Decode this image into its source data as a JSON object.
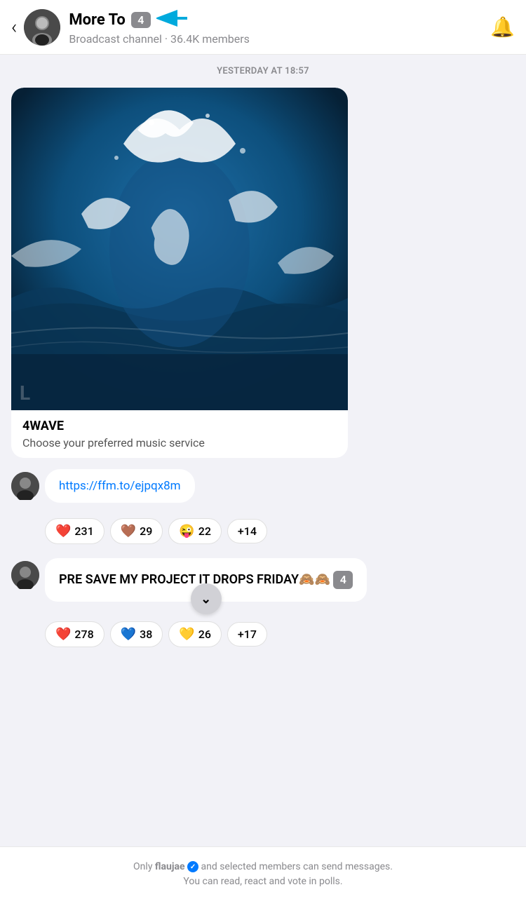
{
  "header": {
    "back_label": "‹",
    "channel_name": "More To",
    "badge_count": "4",
    "channel_type": "Broadcast channel",
    "member_count": "36.4K members",
    "notification_icon": "🔔"
  },
  "chat": {
    "date_divider": "YESTERDAY AT 18:57",
    "message1": {
      "title": "4WAVE",
      "subtitle": "Choose your preferred music service",
      "link": "https://ffm.to/ejpqx8m",
      "reactions": [
        {
          "emoji": "❤️",
          "count": "231"
        },
        {
          "emoji": "🤎",
          "count": "29"
        },
        {
          "emoji": "😜",
          "count": "22"
        },
        {
          "label": "+14"
        }
      ]
    },
    "message2": {
      "text": "PRE SAVE MY PROJECT IT DROPS FRIDAY🙈🙈",
      "badge": "4",
      "reactions": [
        {
          "emoji": "❤️",
          "count": "278"
        },
        {
          "emoji": "💙",
          "count": "38"
        },
        {
          "emoji": "💛",
          "count": "26"
        },
        {
          "label": "+17"
        }
      ]
    }
  },
  "footer": {
    "line1": "Only flaujae",
    "verified_text": "✓",
    "line2": "and selected members can send messages.",
    "line3": "You can read, react and vote in polls."
  }
}
